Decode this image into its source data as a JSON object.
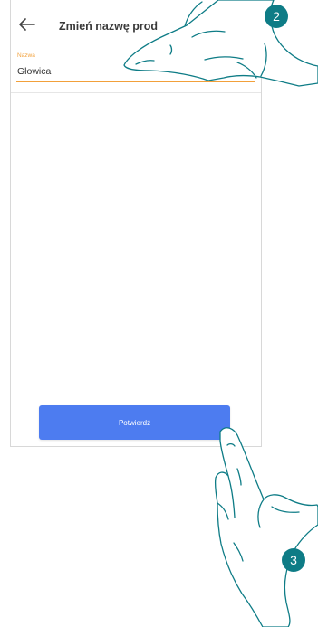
{
  "screen": {
    "title": "Zmień nazwę prod",
    "back_icon": "arrow-left-icon"
  },
  "name_field": {
    "label": "Nazwa",
    "value": "Głowica"
  },
  "confirm_button": {
    "label": "Potwierdź"
  },
  "steps": {
    "step_2": "2",
    "step_3": "3"
  },
  "colors": {
    "accent": "#f2a03a",
    "button": "#4d7cf0",
    "badge": "#0e7c86"
  }
}
